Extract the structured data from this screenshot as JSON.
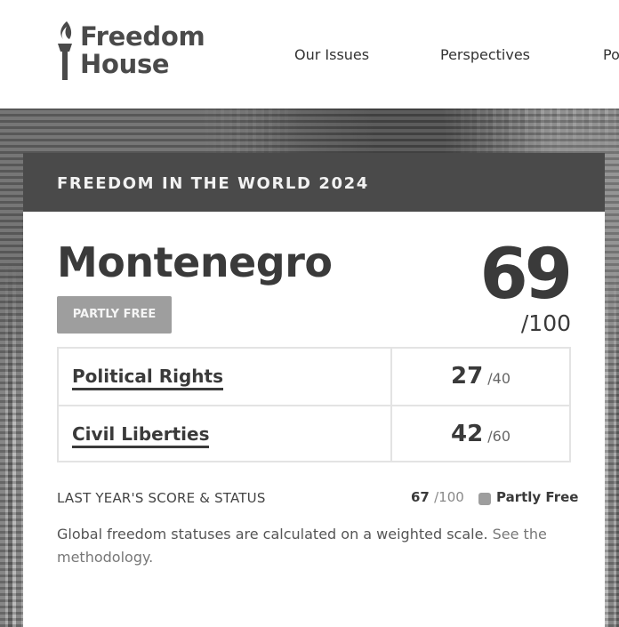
{
  "header": {
    "logo_line1": "Freedom",
    "logo_line2": "House",
    "nav": [
      "Our Issues",
      "Perspectives",
      "Po"
    ]
  },
  "card": {
    "banner": "FREEDOM IN THE WORLD 2024",
    "country": "Montenegro",
    "status": "PARTLY FREE",
    "total_score": "69",
    "total_max": "/100",
    "categories": [
      {
        "label": "Political Rights",
        "score": "27",
        "max": "/40"
      },
      {
        "label": "Civil Liberties",
        "score": "42",
        "max": "/60"
      }
    ],
    "last_year": {
      "label": "LAST YEAR'S SCORE & STATUS",
      "score": "67",
      "max": "/100",
      "status": "Partly Free"
    },
    "note_text": "Global freedom statuses are calculated on a weighted scale.",
    "note_link": "See the methodology."
  },
  "colors": {
    "banner_bg": "#4a4a4a",
    "status_badge": "#9e9e9e",
    "text_dark": "#3a3a3a"
  },
  "icons": [
    "torch-icon"
  ]
}
